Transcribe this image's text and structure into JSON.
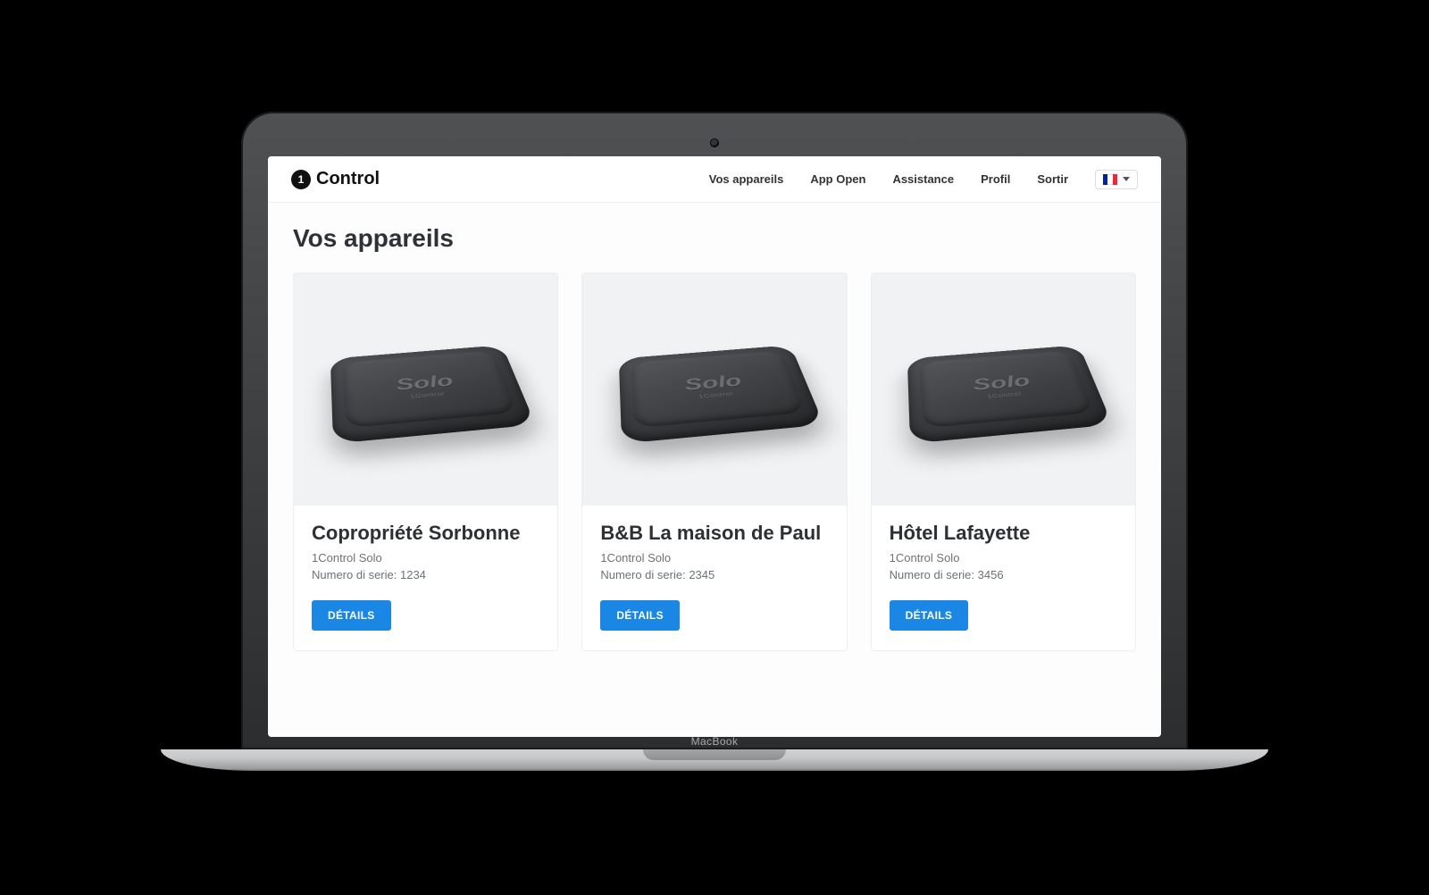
{
  "brand": {
    "logo_mark": "1",
    "logo_text": "Control",
    "laptop_brand": "MacBook"
  },
  "nav": {
    "items": [
      {
        "label": "Vos appareils"
      },
      {
        "label": "App Open"
      },
      {
        "label": "Assistance"
      },
      {
        "label": "Profil"
      },
      {
        "label": "Sortir"
      }
    ],
    "language_code": "fr"
  },
  "page": {
    "title": "Vos appareils",
    "details_label": "DÉTAILS",
    "serial_prefix": "Numero di serie: "
  },
  "devices": [
    {
      "name": "Copropriété Sorbonne",
      "model": "1Control Solo",
      "serial": "1234",
      "device_text": "Solo",
      "device_subtext": "1Control"
    },
    {
      "name": "B&B La maison de Paul",
      "model": "1Control Solo",
      "serial": "2345",
      "device_text": "Solo",
      "device_subtext": "1Control"
    },
    {
      "name": "Hôtel Lafayette",
      "model": "1Control Solo",
      "serial": "3456",
      "device_text": "Solo",
      "device_subtext": "1Control"
    }
  ],
  "colors": {
    "primary": "#1b87e5",
    "text": "#2d3034",
    "muted": "#6d7278",
    "card_bg": "#ffffff",
    "image_bg": "#f1f2f3"
  }
}
